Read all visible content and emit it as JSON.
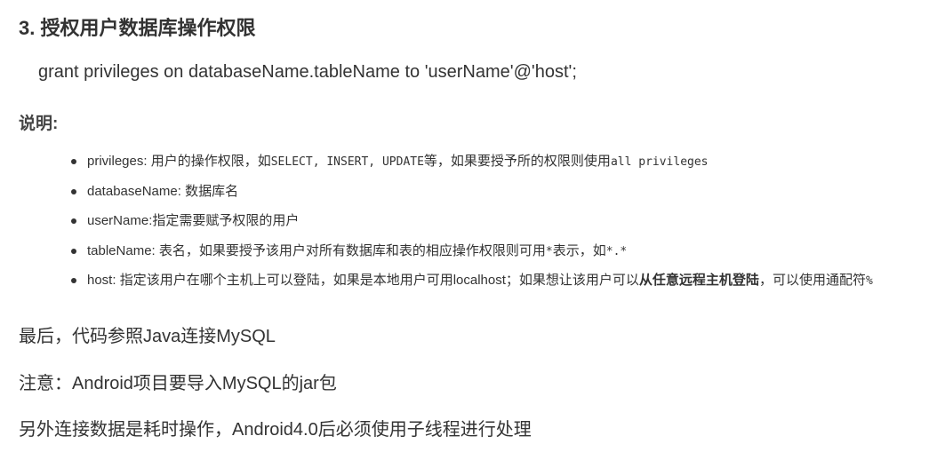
{
  "heading": "3. 授权用户数据库操作权限",
  "code_line": "grant privileges on databaseName.tableName to 'userName'@'host';",
  "note_label": "说明:",
  "bullets": [
    {
      "term": "privileges",
      "sep": ": ",
      "text_a": "用户的操作权限，如",
      "mono_a": "SELECT, INSERT, UPDATE",
      "text_b": "等，如果要授予所的权限则使用",
      "mono_b": "all privileges"
    },
    {
      "term": "databaseName",
      "sep": ": ",
      "text_a": "数据库名"
    },
    {
      "term": "userName",
      "sep": ":",
      "text_a": "指定需要赋予权限的用户"
    },
    {
      "term": "tableName",
      "sep": ": ",
      "text_a": "表名，如果要授予该用户对所有数据库和表的相应操作权限则可用",
      "mono_a": "*",
      "text_b": "表示，如",
      "mono_b": "*.*"
    },
    {
      "term": "host",
      "sep": ": ",
      "text_a": "指定该用户在哪个主机上可以登陆，如果是本地用户可用localhost；如果想让该用户可以",
      "strong_a": "从任意远程主机登陆",
      "text_b": "，可以使用通配符",
      "mono_b": "%"
    }
  ],
  "paragraphs": [
    "最后，代码参照Java连接MySQL",
    "注意：Android项目要导入MySQL的jar包",
    "另外连接数据是耗时操作，Android4.0后必须使用子线程进行处理"
  ]
}
